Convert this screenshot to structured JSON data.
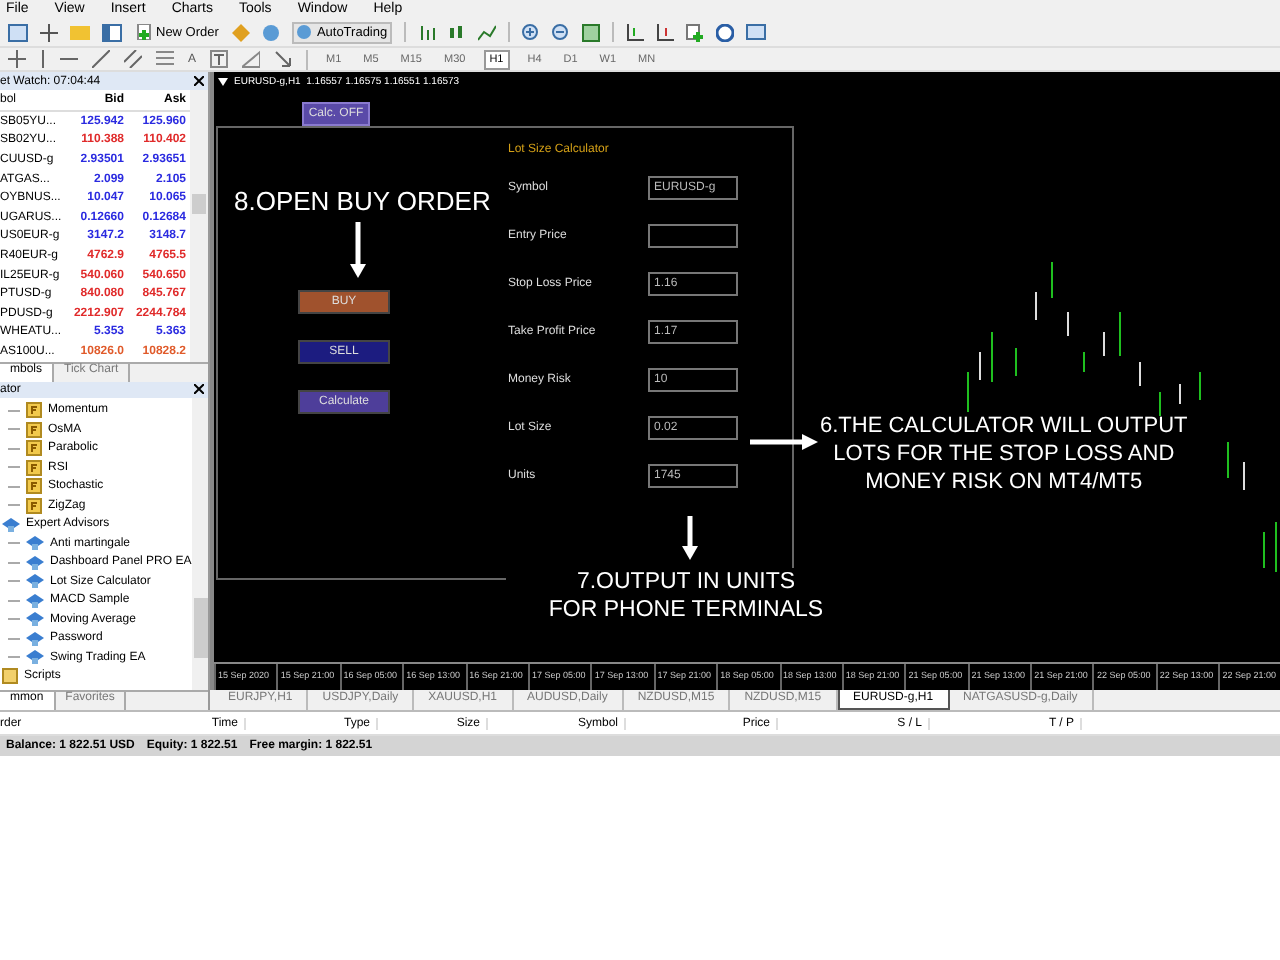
{
  "menu": [
    "File",
    "View",
    "Insert",
    "Charts",
    "Tools",
    "Window",
    "Help"
  ],
  "toolbar": {
    "new_order": "New Order",
    "autotrading": "AutoTrading"
  },
  "drawing_toolbar": {
    "text_tool": "A",
    "timeframes": [
      {
        "label": "M1",
        "selected": false
      },
      {
        "label": "M5",
        "selected": false
      },
      {
        "label": "M15",
        "selected": false
      },
      {
        "label": "M30",
        "selected": false
      },
      {
        "label": "H1",
        "selected": true
      },
      {
        "label": "H4",
        "selected": false
      },
      {
        "label": "D1",
        "selected": false
      },
      {
        "label": "W1",
        "selected": false
      },
      {
        "label": "MN",
        "selected": false
      }
    ]
  },
  "market_watch": {
    "title": "et Watch: 07:04:44",
    "columns": [
      "bol",
      "Bid",
      "Ask"
    ],
    "rows": [
      {
        "symbol": "SB05YU...",
        "bid": "125.942",
        "ask": "125.960",
        "color": "#2a2ae0"
      },
      {
        "symbol": "SB02YU...",
        "bid": "110.388",
        "ask": "110.402",
        "color": "#e02a2a"
      },
      {
        "symbol": "CUUSD-g",
        "bid": "2.93501",
        "ask": "2.93651",
        "color": "#2a2ae0"
      },
      {
        "symbol": "ATGAS...",
        "bid": "2.099",
        "ask": "2.105",
        "color": "#2a2ae0"
      },
      {
        "symbol": "OYBNUS...",
        "bid": "10.047",
        "ask": "10.065",
        "color": "#2a2ae0"
      },
      {
        "symbol": "UGARUS...",
        "bid": "0.12660",
        "ask": "0.12684",
        "color": "#2a2ae0"
      },
      {
        "symbol": "US0EUR-g",
        "bid": "3147.2",
        "ask": "3148.7",
        "color": "#2a2ae0"
      },
      {
        "symbol": "R40EUR-g",
        "bid": "4762.9",
        "ask": "4765.5",
        "color": "#e02a2a"
      },
      {
        "symbol": "IL25EUR-g",
        "bid": "540.060",
        "ask": "540.650",
        "color": "#e02a2a"
      },
      {
        "symbol": "PTUSD-g",
        "bid": "840.080",
        "ask": "845.767",
        "color": "#e02a2a"
      },
      {
        "symbol": "PDUSD-g",
        "bid": "2212.907",
        "ask": "2244.784",
        "color": "#e02a2a"
      },
      {
        "symbol": "WHEATU...",
        "bid": "5.353",
        "ask": "5.363",
        "color": "#2a2ae0"
      },
      {
        "symbol": "AS100U...",
        "bid": "10826.0",
        "ask": "10828.2",
        "color": "#e05a2a"
      }
    ],
    "tabs": [
      {
        "label": "mbols",
        "selected": true
      },
      {
        "label": "Tick Chart",
        "selected": false
      }
    ]
  },
  "navigator": {
    "title": "ator",
    "items": [
      {
        "kind": "indicators",
        "children": [
          {
            "label": "Momentum"
          },
          {
            "label": "OsMA"
          },
          {
            "label": "Parabolic"
          },
          {
            "label": "RSI"
          },
          {
            "label": "Stochastic"
          },
          {
            "label": "ZigZag"
          }
        ]
      },
      {
        "kind": "experts",
        "label": "Expert Advisors",
        "children": [
          {
            "label": "Anti martingale"
          },
          {
            "label": "Dashboard Panel PRO EA"
          },
          {
            "label": "Lot Size Calculator"
          },
          {
            "label": "MACD Sample"
          },
          {
            "label": "Moving Average"
          },
          {
            "label": "Password"
          },
          {
            "label": "Swing Trading EA"
          }
        ]
      },
      {
        "kind": "scripts",
        "label": "Scripts"
      }
    ],
    "tabs": [
      {
        "label": "mmon",
        "selected": true
      },
      {
        "label": "Favorites",
        "selected": false
      }
    ]
  },
  "chart": {
    "header": "EURUSD-g,H1  1.16557 1.16575 1.16551 1.16573",
    "calc_button": "Calc. OFF",
    "calculator": {
      "title": "Lot Size Calculator",
      "buttons": [
        {
          "label": "BUY",
          "kind": "buy"
        },
        {
          "label": "SELL",
          "kind": "sell"
        },
        {
          "label": "Calculate",
          "kind": "calc"
        }
      ],
      "fields": [
        {
          "label": "Symbol",
          "value": "EURUSD-g"
        },
        {
          "label": "Entry Price"
        },
        {
          "label": "Stop Loss Price",
          "value": "1.16"
        },
        {
          "label": "Take Profit Price",
          "value": "1.17"
        },
        {
          "label": "Money Risk",
          "value": "10"
        },
        {
          "label": "Lot Size",
          "value": "0.02"
        },
        {
          "label": "Units",
          "value": "1745"
        }
      ]
    },
    "annotation_buy": "8.OPEN BUY ORDER",
    "annotation_lots": "6.THE CALCULATOR WILL OUTPUT\nLOTS FOR THE STOP LOSS AND\nMONEY RISK ON MT4/MT5",
    "annotation_units": "7.OUTPUT IN UNITS\nFOR PHONE TERMINALS",
    "time_axis": [
      "15 Sep 2020",
      "15 Sep 21:00",
      "16 Sep 05:00",
      "16 Sep 13:00",
      "16 Sep 21:00",
      "17 Sep 05:00",
      "17 Sep 13:00",
      "17 Sep 21:00",
      "18 Sep 05:00",
      "18 Sep 13:00",
      "18 Sep 21:00",
      "21 Sep 05:00",
      "21 Sep 13:00",
      "21 Sep 21:00",
      "22 Sep 05:00",
      "22 Sep 13:00",
      "22 Sep 21:00"
    ]
  },
  "chart_tabs": [
    {
      "label": "EURJPY,H1",
      "selected": false
    },
    {
      "label": "USDJPY,Daily",
      "selected": false
    },
    {
      "label": "XAUUSD,H1",
      "selected": false
    },
    {
      "label": "AUDUSD,Daily",
      "selected": false
    },
    {
      "label": "NZDUSD,M15",
      "selected": false
    },
    {
      "label": "NZDUSD,M15",
      "selected": false
    },
    {
      "label": "EURUSD-g,H1",
      "selected": true
    },
    {
      "label": "NATGASUSD-g,Daily",
      "selected": false
    }
  ],
  "terminal": {
    "columns": [
      "rder",
      "Time",
      "Type",
      "Size",
      "Symbol",
      "Price",
      "S / L",
      "T / P"
    ],
    "status": [
      "Balance: 1 822.51 USD",
      "Equity: 1 822.51",
      "Free margin: 1 822.51"
    ]
  }
}
